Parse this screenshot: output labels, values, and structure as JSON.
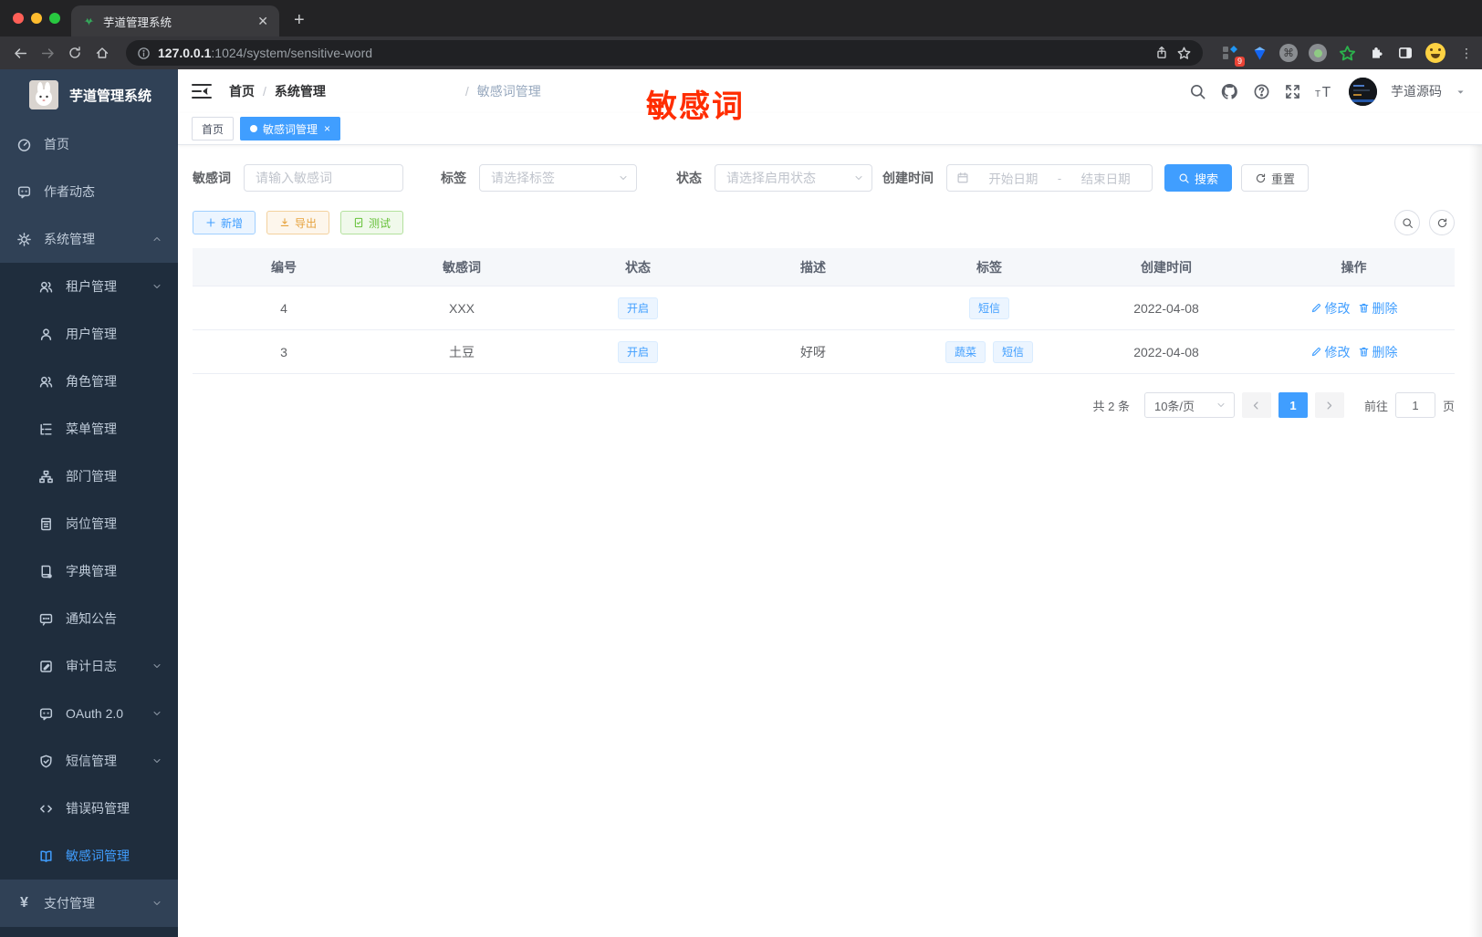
{
  "browser": {
    "tab_title": "芋道管理系统",
    "url": {
      "host": "127.0.0.1",
      "path": ":1024/system/sensitive-word"
    },
    "extension_badge": "9"
  },
  "header": {
    "breadcrumb": [
      "首页",
      "系统管理",
      "敏感词管理"
    ],
    "sep": "/",
    "annotation": "敏感词",
    "username": "芋道源码"
  },
  "tags_bar": {
    "home": "首页",
    "active": "敏感词管理"
  },
  "sidebar": {
    "title": "芋道管理系统",
    "items": [
      {
        "label": "首页",
        "icon": "dashboard-icon"
      },
      {
        "label": "作者动态",
        "icon": "chat-icon"
      },
      {
        "label": "系统管理",
        "icon": "gear-icon"
      },
      {
        "label": "租户管理",
        "icon": "users-icon"
      },
      {
        "label": "用户管理",
        "icon": "user-icon"
      },
      {
        "label": "角色管理",
        "icon": "users-icon"
      },
      {
        "label": "菜单管理",
        "icon": "menu-tree-icon"
      },
      {
        "label": "部门管理",
        "icon": "org-icon"
      },
      {
        "label": "岗位管理",
        "icon": "badge-icon"
      },
      {
        "label": "字典管理",
        "icon": "dict-book-icon"
      },
      {
        "label": "通知公告",
        "icon": "message-icon"
      },
      {
        "label": "审计日志",
        "icon": "edit-log-icon"
      },
      {
        "label": "OAuth 2.0",
        "icon": "chat-round-icon"
      },
      {
        "label": "短信管理",
        "icon": "shield-check-icon"
      },
      {
        "label": "错误码管理",
        "icon": "code-icon"
      },
      {
        "label": "敏感词管理",
        "icon": "open-book-icon"
      },
      {
        "label": "支付管理",
        "icon": "yen-icon"
      }
    ]
  },
  "filters": {
    "keyword": {
      "label": "敏感词",
      "placeholder": "请输入敏感词"
    },
    "tag": {
      "label": "标签",
      "placeholder": "请选择标签"
    },
    "status": {
      "label": "状态",
      "placeholder": "请选择启用状态"
    },
    "create_time": {
      "label": "创建时间",
      "start_placeholder": "开始日期",
      "separator": "-",
      "end_placeholder": "结束日期"
    },
    "search_label": "搜索",
    "reset_label": "重置"
  },
  "toolbar": {
    "add_label": "新增",
    "export_label": "导出",
    "test_label": "测试"
  },
  "table": {
    "columns": [
      "编号",
      "敏感词",
      "状态",
      "描述",
      "标签",
      "创建时间",
      "操作"
    ],
    "rows": [
      {
        "id": "4",
        "word": "XXX",
        "status": "开启",
        "description": "",
        "tags": [
          "短信"
        ],
        "create_time": "2022-04-08"
      },
      {
        "id": "3",
        "word": "土豆",
        "status": "开启",
        "description": "好呀",
        "tags": [
          "蔬菜",
          "短信"
        ],
        "create_time": "2022-04-08"
      }
    ],
    "edit_label": "修改",
    "delete_label": "删除"
  },
  "pagination": {
    "total_text": "共 2 条",
    "page_size": "10条/页",
    "current_page": "1",
    "goto_label": "前往",
    "goto_value": "1",
    "page_unit": "页"
  },
  "colors": {
    "primary": "#409eff",
    "annotation_red": "#ff2d00",
    "sidebar_bg": "#304156",
    "submenu_bg": "#1f2d3d",
    "tag_blue_bg": "#ecf5ff"
  }
}
